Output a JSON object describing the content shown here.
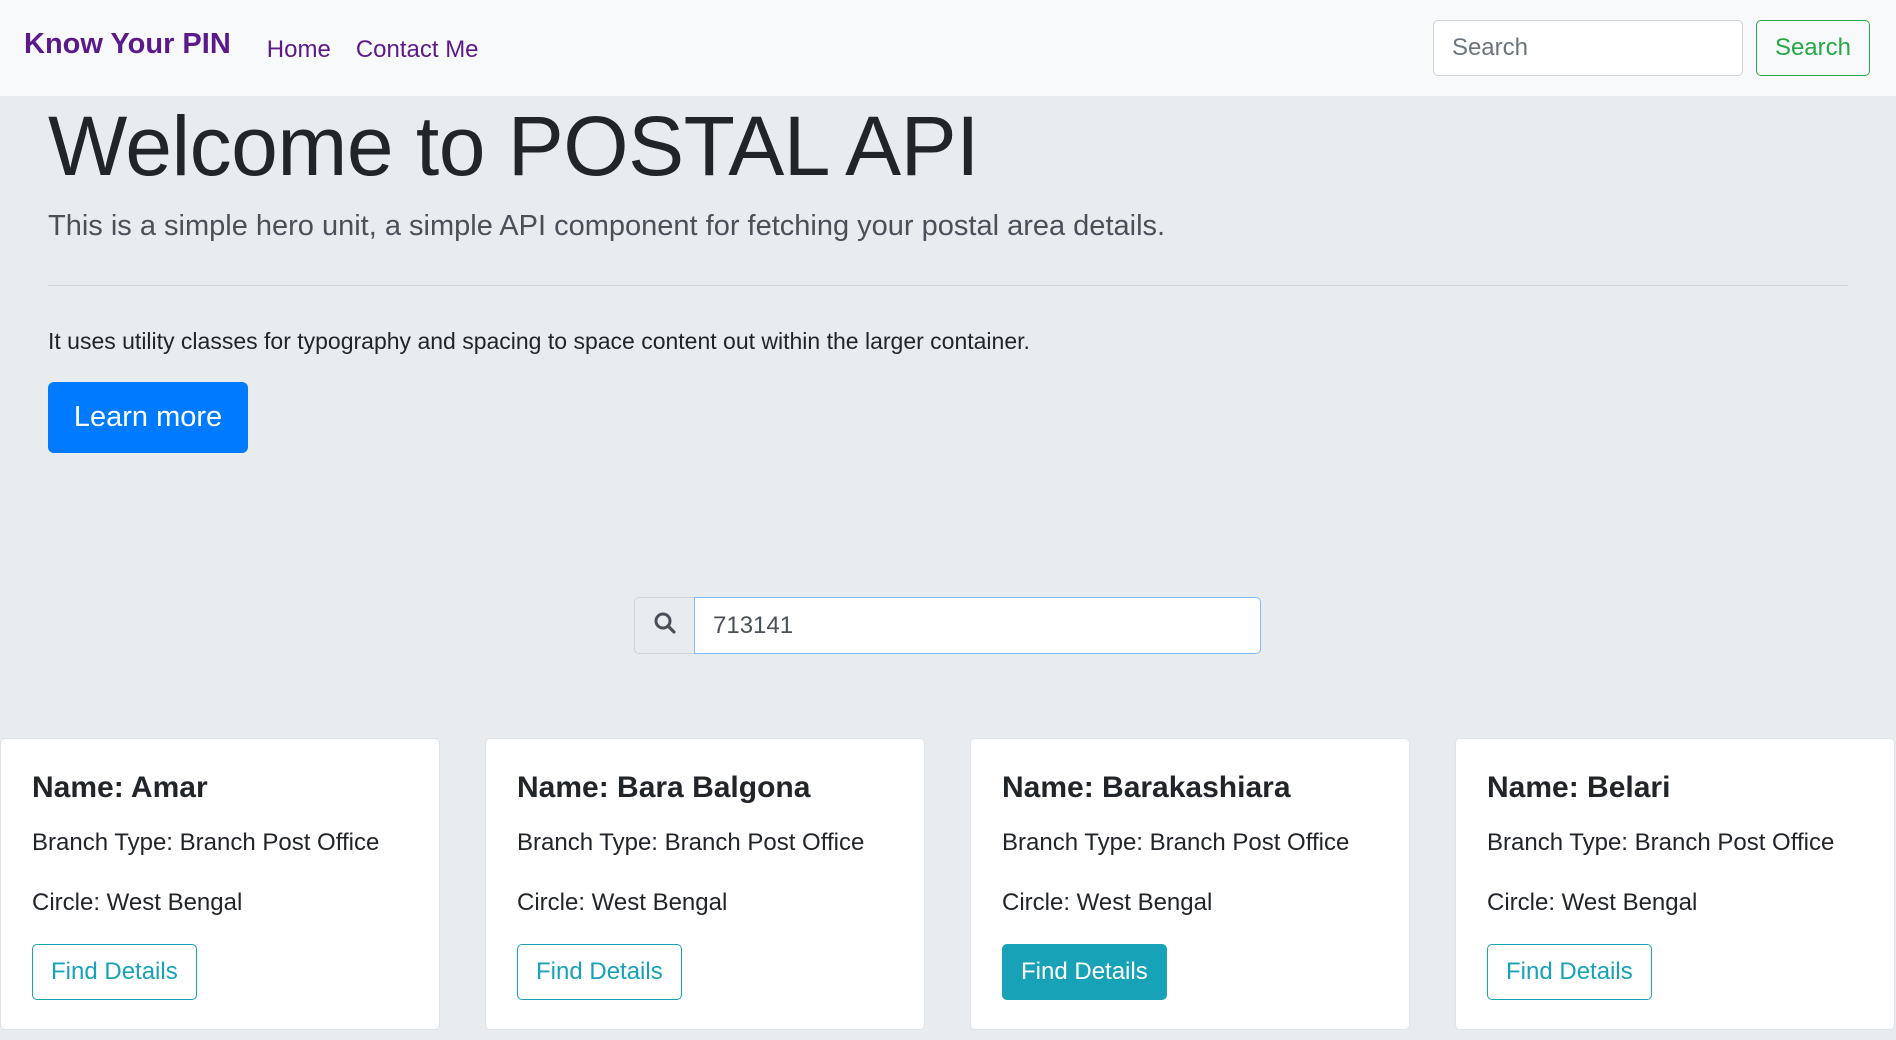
{
  "navbar": {
    "brand": "Know Your PIN",
    "links": [
      {
        "label": "Home"
      },
      {
        "label": "Contact Me"
      }
    ],
    "search_placeholder": "Search",
    "search_button": "Search",
    "brand_color": "#5b1a8b",
    "accent_color": "#28a745"
  },
  "hero": {
    "title": "Welcome to POSTAL API",
    "lead": "This is a simple hero unit, a simple API component for fetching your postal area details.",
    "text": "It uses utility classes for typography and spacing to space content out within the larger container.",
    "button": "Learn more",
    "button_color": "#007bff"
  },
  "pin_search": {
    "icon": "search-icon",
    "value": "713141"
  },
  "cards": [
    {
      "name": "Name: Amar",
      "branch": "Branch Type: Branch Post Office",
      "circle": "Circle: West Bengal",
      "button": "Find Details",
      "active": false
    },
    {
      "name": "Name: Bara Balgona",
      "branch": "Branch Type: Branch Post Office",
      "circle": "Circle: West Bengal",
      "button": "Find Details",
      "active": false
    },
    {
      "name": "Name: Barakashiara",
      "branch": "Branch Type: Branch Post Office",
      "circle": "Circle: West Bengal",
      "button": "Find Details",
      "active": true
    },
    {
      "name": "Name: Belari",
      "branch": "Branch Type: Branch Post Office",
      "circle": "Circle: West Bengal",
      "button": "Find Details",
      "active": false
    }
  ]
}
